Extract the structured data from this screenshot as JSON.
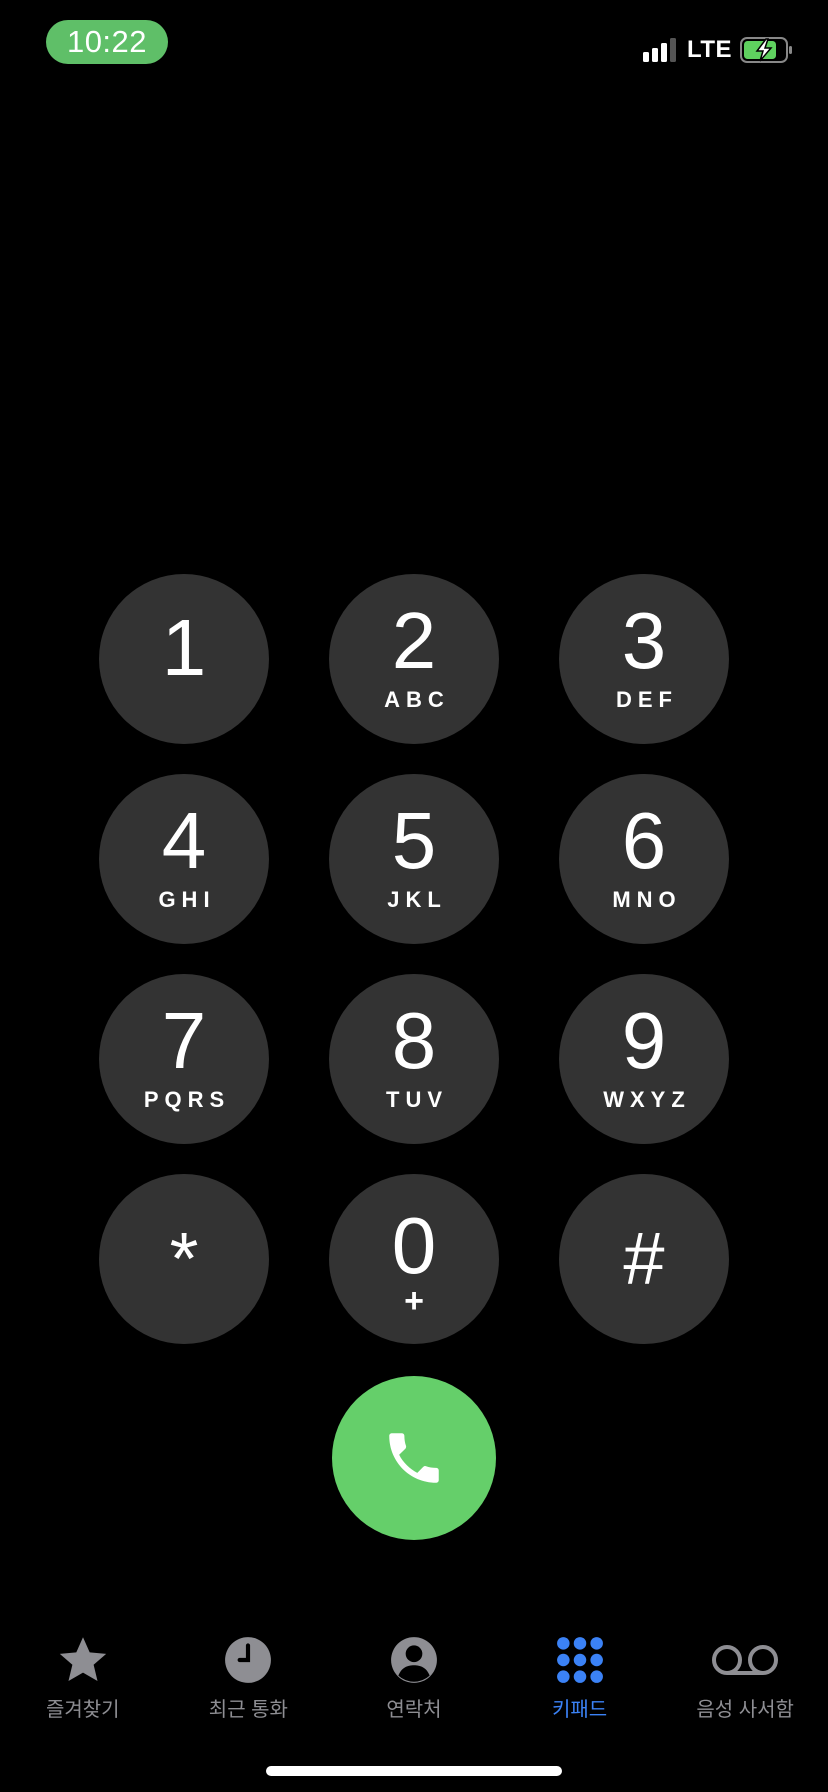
{
  "status_bar": {
    "time": "10:22",
    "network": "LTE",
    "time_pill_color": "#5fbf68",
    "battery_color": "#5fd15f",
    "signal_bars": 3,
    "charging": true
  },
  "keypad": {
    "keys": [
      {
        "digit": "1",
        "letters": ""
      },
      {
        "digit": "2",
        "letters": "ABC"
      },
      {
        "digit": "3",
        "letters": "DEF"
      },
      {
        "digit": "4",
        "letters": "GHI"
      },
      {
        "digit": "5",
        "letters": "JKL"
      },
      {
        "digit": "6",
        "letters": "MNO"
      },
      {
        "digit": "7",
        "letters": "PQRS"
      },
      {
        "digit": "8",
        "letters": "TUV"
      },
      {
        "digit": "9",
        "letters": "WXYZ"
      },
      {
        "digit": "*",
        "letters": ""
      },
      {
        "digit": "0",
        "letters": "+"
      },
      {
        "digit": "#",
        "letters": ""
      }
    ],
    "key_color": "#333333"
  },
  "call_button": {
    "icon": "phone-icon",
    "color": "#65cf6a"
  },
  "tabbar": {
    "tabs": [
      {
        "label": "즐겨찾기",
        "icon": "star-icon",
        "active": false
      },
      {
        "label": "최근 통화",
        "icon": "clock-icon",
        "active": false
      },
      {
        "label": "연락처",
        "icon": "person-icon",
        "active": false
      },
      {
        "label": "키패드",
        "icon": "keypad-icon",
        "active": true
      },
      {
        "label": "음성 사서함",
        "icon": "voicemail-icon",
        "active": false
      }
    ],
    "active_color": "#3b82f6",
    "inactive_color": "#8e8e93"
  }
}
